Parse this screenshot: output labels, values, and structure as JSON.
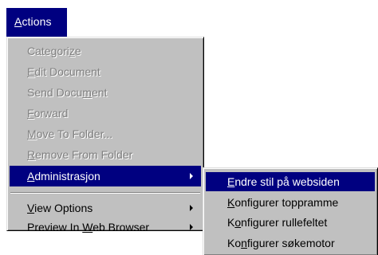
{
  "menubar": {
    "actions_label": "Actions",
    "actions_mnemonic_index": 0
  },
  "actions_menu": {
    "items": [
      {
        "label": "Categorize",
        "mnemonic": "z",
        "enabled": false
      },
      {
        "label": "Edit Document",
        "mnemonic": "E",
        "enabled": false
      },
      {
        "label": "Send Document",
        "mnemonic": "m",
        "enabled": false
      },
      {
        "label": "Forward",
        "mnemonic": "F",
        "enabled": false
      },
      {
        "label": "Move To Folder...",
        "mnemonic": "M",
        "enabled": false
      },
      {
        "label": "Remove From Folder",
        "mnemonic": "R",
        "enabled": false
      },
      {
        "label": "Administrasjon",
        "mnemonic": "A",
        "enabled": true,
        "highlighted": true,
        "submenu": true
      },
      {
        "label": "View Options",
        "mnemonic": "V",
        "enabled": true,
        "submenu": true
      },
      {
        "label": "Preview In Web Browser",
        "mnemonic": "W",
        "enabled": true,
        "submenu": true
      }
    ]
  },
  "admin_submenu": {
    "items": [
      {
        "label": "Endre stil på websiden",
        "mnemonic": "E",
        "highlighted": true
      },
      {
        "label": "Konfigurer toppramme",
        "mnemonic": "K"
      },
      {
        "label": "Konfigurer rullefeltet",
        "mnemonic": "o"
      },
      {
        "label": "Konfigurer søkemotor",
        "mnemonic": "n"
      }
    ]
  },
  "colors": {
    "menu_face": "#c0c0c0",
    "highlight": "#000080",
    "disabled_text": "#808080"
  }
}
